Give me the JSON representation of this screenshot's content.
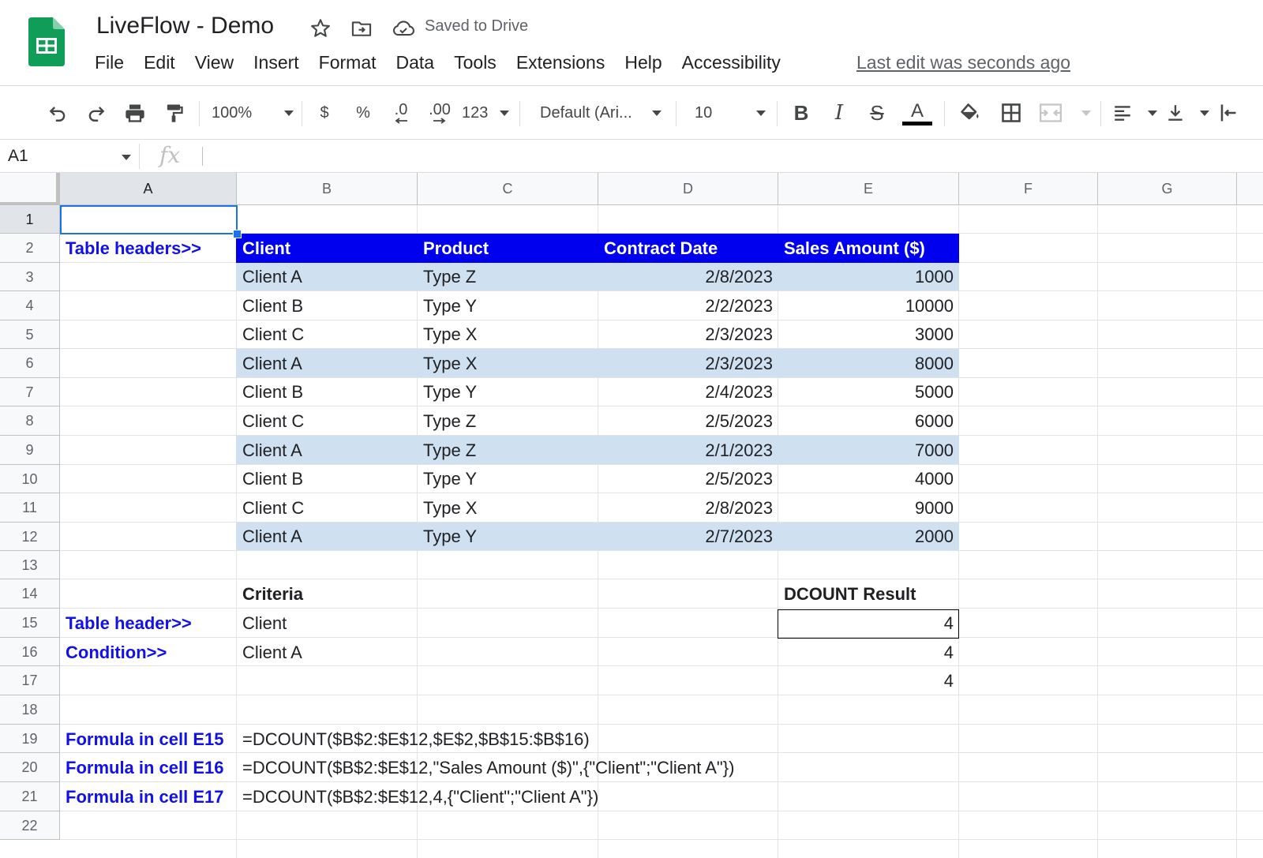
{
  "app": {
    "title": "LiveFlow - Demo",
    "saved_status": "Saved to Drive",
    "last_edit": "Last edit was seconds ago",
    "brand_color": "#0f9d58"
  },
  "menu": [
    "File",
    "Edit",
    "View",
    "Insert",
    "Format",
    "Data",
    "Tools",
    "Extensions",
    "Help",
    "Accessibility"
  ],
  "toolbar": {
    "zoom": "100%",
    "currency": "$",
    "percent": "%",
    "dec_decrease": ".0",
    "dec_increase": ".00",
    "number_format": "123",
    "font": "Default (Ari...",
    "font_size": "10"
  },
  "formula_bar": {
    "name_box": "A1",
    "fx": "fx",
    "content": ""
  },
  "columns": [
    "A",
    "B",
    "C",
    "D",
    "E",
    "F",
    "G"
  ],
  "rows": [
    "1",
    "2",
    "3",
    "4",
    "5",
    "6",
    "7",
    "8",
    "9",
    "10",
    "11",
    "12",
    "13",
    "14",
    "15",
    "16",
    "17",
    "18",
    "19",
    "20",
    "21",
    "22"
  ],
  "selected_cell": "A1",
  "colors": {
    "header_fill": "#0000ee",
    "band_fill": "#cfe0f1",
    "label_text": "#1111e8",
    "selection": "#1a73e8"
  },
  "sheet": {
    "a2_label": "Table headers>>",
    "table_headers": [
      "Client",
      "Product",
      "Contract Date",
      "Sales Amount ($)"
    ],
    "table_rows": [
      {
        "client": "Client A",
        "product": "Type Z",
        "date": "2/8/2023",
        "amount": "1000",
        "band": true
      },
      {
        "client": "Client B",
        "product": "Type Y",
        "date": "2/2/2023",
        "amount": "10000",
        "band": false
      },
      {
        "client": "Client C",
        "product": "Type X",
        "date": "2/3/2023",
        "amount": "3000",
        "band": false
      },
      {
        "client": "Client A",
        "product": "Type X",
        "date": "2/3/2023",
        "amount": "8000",
        "band": true
      },
      {
        "client": "Client B",
        "product": "Type Y",
        "date": "2/4/2023",
        "amount": "5000",
        "band": false
      },
      {
        "client": "Client C",
        "product": "Type Z",
        "date": "2/5/2023",
        "amount": "6000",
        "band": false
      },
      {
        "client": "Client A",
        "product": "Type Z",
        "date": "2/1/2023",
        "amount": "7000",
        "band": true
      },
      {
        "client": "Client B",
        "product": "Type Y",
        "date": "2/5/2023",
        "amount": "4000",
        "band": false
      },
      {
        "client": "Client C",
        "product": "Type X",
        "date": "2/8/2023",
        "amount": "9000",
        "band": false
      },
      {
        "client": "Client A",
        "product": "Type Y",
        "date": "2/7/2023",
        "amount": "2000",
        "band": true
      }
    ],
    "criteria_title": "Criteria",
    "result_title": "DCOUNT Result",
    "a15_label": "Table header>>",
    "b15_value": "Client",
    "a16_label": "Condition>>",
    "b16_value": "Client A",
    "results": [
      "4",
      "4",
      "4"
    ],
    "formulas": [
      {
        "label": "Formula in cell E15",
        "formula": "=DCOUNT($B$2:$E$12,$E$2,$B$15:$B$16)"
      },
      {
        "label": "Formula in cell E16",
        "formula": "=DCOUNT($B$2:$E$12,\"Sales Amount ($)\",{\"Client\";\"Client A\"})"
      },
      {
        "label": "Formula in cell E17",
        "formula": "=DCOUNT($B$2:$E$12,4,{\"Client\";\"Client A\"})"
      }
    ]
  }
}
